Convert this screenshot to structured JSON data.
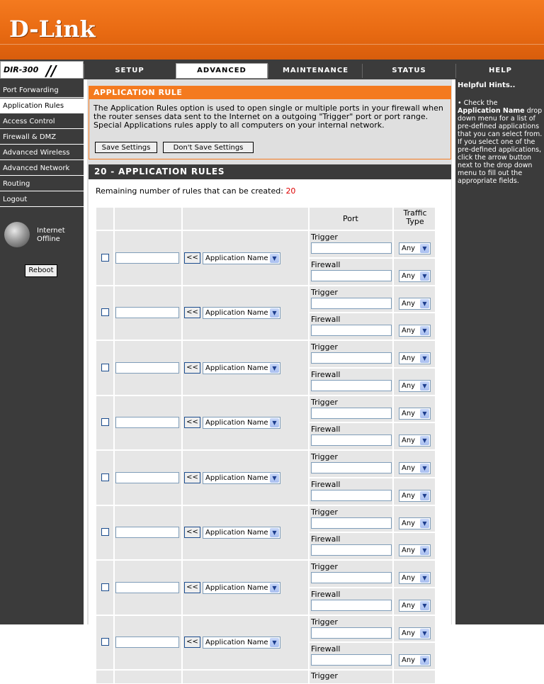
{
  "brand": {
    "logo": "D-Link"
  },
  "model": "DIR-300",
  "tabs": [
    "SETUP",
    "ADVANCED",
    "MAINTENANCE",
    "STATUS",
    "HELP"
  ],
  "sidebar": {
    "items": [
      "Port Forwarding",
      "Application Rules",
      "Access Control",
      "Firewall & DMZ",
      "Advanced Wireless",
      "Advanced Network",
      "Routing",
      "Logout"
    ],
    "active_index": 1,
    "internet_status": [
      "Internet",
      "Offline"
    ],
    "reboot_label": "Reboot"
  },
  "help": {
    "title": "Helpful Hints..",
    "bullet": "•",
    "text_pre": "Check the ",
    "text_bold": "Application Name",
    "text_post": " drop down menu for a list of pre-defined applications that you can select from. If you select one of the pre-defined applications, click the arrow button next to the drop down menu to fill out the appropriate fields."
  },
  "app_rule": {
    "title": "APPLICATION RULE",
    "description": "The Application Rules option is used to open single or multiple ports in your firewall when the router senses data sent to the Internet on a outgoing \"Trigger\" port or port range. Special Applications rules apply to all computers on your internal network.",
    "save_label": "Save Settings",
    "dont_save_label": "Don't Save Settings"
  },
  "rules": {
    "title": "20 - APPLICATION RULES",
    "remaining_label": "Remaining number of rules that can be created:",
    "remaining_count": "20",
    "col_port": "Port",
    "col_traffic": "Traffic Type",
    "trigger_label": "Trigger",
    "firewall_label": "Firewall",
    "copy_button": "<<",
    "app_select": "Application Name",
    "traffic_value": "Any",
    "visible_rows": 8
  }
}
